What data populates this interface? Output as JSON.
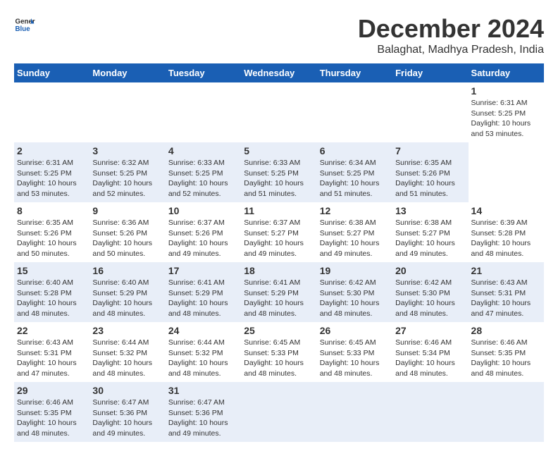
{
  "header": {
    "logo_line1": "General",
    "logo_line2": "Blue",
    "title": "December 2024",
    "subtitle": "Balaghat, Madhya Pradesh, India"
  },
  "calendar": {
    "days_of_week": [
      "Sunday",
      "Monday",
      "Tuesday",
      "Wednesday",
      "Thursday",
      "Friday",
      "Saturday"
    ],
    "weeks": [
      [
        {
          "day": "",
          "info": ""
        },
        {
          "day": "",
          "info": ""
        },
        {
          "day": "",
          "info": ""
        },
        {
          "day": "",
          "info": ""
        },
        {
          "day": "",
          "info": ""
        },
        {
          "day": "",
          "info": ""
        },
        {
          "day": "1",
          "info": "Sunrise: 6:31 AM\nSunset: 5:25 PM\nDaylight: 10 hours\nand 53 minutes."
        }
      ],
      [
        {
          "day": "2",
          "info": "Sunrise: 6:31 AM\nSunset: 5:25 PM\nDaylight: 10 hours\nand 53 minutes."
        },
        {
          "day": "3",
          "info": "Sunrise: 6:32 AM\nSunset: 5:25 PM\nDaylight: 10 hours\nand 52 minutes."
        },
        {
          "day": "4",
          "info": "Sunrise: 6:33 AM\nSunset: 5:25 PM\nDaylight: 10 hours\nand 52 minutes."
        },
        {
          "day": "5",
          "info": "Sunrise: 6:33 AM\nSunset: 5:25 PM\nDaylight: 10 hours\nand 51 minutes."
        },
        {
          "day": "6",
          "info": "Sunrise: 6:34 AM\nSunset: 5:25 PM\nDaylight: 10 hours\nand 51 minutes."
        },
        {
          "day": "7",
          "info": "Sunrise: 6:35 AM\nSunset: 5:26 PM\nDaylight: 10 hours\nand 51 minutes."
        }
      ],
      [
        {
          "day": "8",
          "info": "Sunrise: 6:35 AM\nSunset: 5:26 PM\nDaylight: 10 hours\nand 50 minutes."
        },
        {
          "day": "9",
          "info": "Sunrise: 6:36 AM\nSunset: 5:26 PM\nDaylight: 10 hours\nand 50 minutes."
        },
        {
          "day": "10",
          "info": "Sunrise: 6:37 AM\nSunset: 5:26 PM\nDaylight: 10 hours\nand 49 minutes."
        },
        {
          "day": "11",
          "info": "Sunrise: 6:37 AM\nSunset: 5:27 PM\nDaylight: 10 hours\nand 49 minutes."
        },
        {
          "day": "12",
          "info": "Sunrise: 6:38 AM\nSunset: 5:27 PM\nDaylight: 10 hours\nand 49 minutes."
        },
        {
          "day": "13",
          "info": "Sunrise: 6:38 AM\nSunset: 5:27 PM\nDaylight: 10 hours\nand 49 minutes."
        },
        {
          "day": "14",
          "info": "Sunrise: 6:39 AM\nSunset: 5:28 PM\nDaylight: 10 hours\nand 48 minutes."
        }
      ],
      [
        {
          "day": "15",
          "info": "Sunrise: 6:40 AM\nSunset: 5:28 PM\nDaylight: 10 hours\nand 48 minutes."
        },
        {
          "day": "16",
          "info": "Sunrise: 6:40 AM\nSunset: 5:29 PM\nDaylight: 10 hours\nand 48 minutes."
        },
        {
          "day": "17",
          "info": "Sunrise: 6:41 AM\nSunset: 5:29 PM\nDaylight: 10 hours\nand 48 minutes."
        },
        {
          "day": "18",
          "info": "Sunrise: 6:41 AM\nSunset: 5:29 PM\nDaylight: 10 hours\nand 48 minutes."
        },
        {
          "day": "19",
          "info": "Sunrise: 6:42 AM\nSunset: 5:30 PM\nDaylight: 10 hours\nand 48 minutes."
        },
        {
          "day": "20",
          "info": "Sunrise: 6:42 AM\nSunset: 5:30 PM\nDaylight: 10 hours\nand 48 minutes."
        },
        {
          "day": "21",
          "info": "Sunrise: 6:43 AM\nSunset: 5:31 PM\nDaylight: 10 hours\nand 47 minutes."
        }
      ],
      [
        {
          "day": "22",
          "info": "Sunrise: 6:43 AM\nSunset: 5:31 PM\nDaylight: 10 hours\nand 47 minutes."
        },
        {
          "day": "23",
          "info": "Sunrise: 6:44 AM\nSunset: 5:32 PM\nDaylight: 10 hours\nand 48 minutes."
        },
        {
          "day": "24",
          "info": "Sunrise: 6:44 AM\nSunset: 5:32 PM\nDaylight: 10 hours\nand 48 minutes."
        },
        {
          "day": "25",
          "info": "Sunrise: 6:45 AM\nSunset: 5:33 PM\nDaylight: 10 hours\nand 48 minutes."
        },
        {
          "day": "26",
          "info": "Sunrise: 6:45 AM\nSunset: 5:33 PM\nDaylight: 10 hours\nand 48 minutes."
        },
        {
          "day": "27",
          "info": "Sunrise: 6:46 AM\nSunset: 5:34 PM\nDaylight: 10 hours\nand 48 minutes."
        },
        {
          "day": "28",
          "info": "Sunrise: 6:46 AM\nSunset: 5:35 PM\nDaylight: 10 hours\nand 48 minutes."
        }
      ],
      [
        {
          "day": "29",
          "info": "Sunrise: 6:46 AM\nSunset: 5:35 PM\nDaylight: 10 hours\nand 48 minutes."
        },
        {
          "day": "30",
          "info": "Sunrise: 6:47 AM\nSunset: 5:36 PM\nDaylight: 10 hours\nand 49 minutes."
        },
        {
          "day": "31",
          "info": "Sunrise: 6:47 AM\nSunset: 5:36 PM\nDaylight: 10 hours\nand 49 minutes."
        },
        {
          "day": "",
          "info": ""
        },
        {
          "day": "",
          "info": ""
        },
        {
          "day": "",
          "info": ""
        },
        {
          "day": "",
          "info": ""
        }
      ]
    ]
  }
}
